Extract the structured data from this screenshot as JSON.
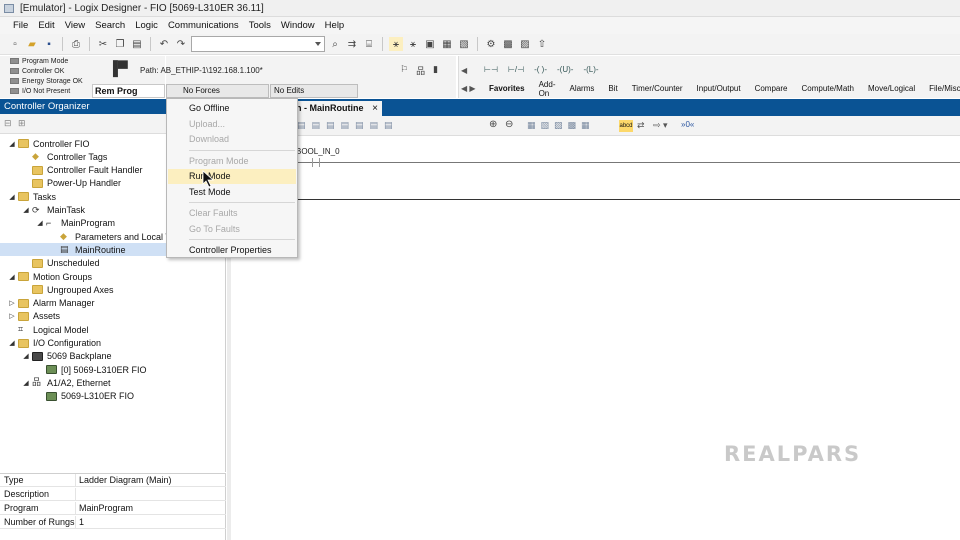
{
  "window": {
    "title": "[Emulator] - Logix Designer - FIO [5069-L310ER 36.11]"
  },
  "menu": [
    "File",
    "Edit",
    "View",
    "Search",
    "Logic",
    "Communications",
    "Tools",
    "Window",
    "Help"
  ],
  "status": {
    "indicators": [
      "Program Mode",
      "Controller OK",
      "Energy Storage OK",
      "I/O Not Present"
    ],
    "mode": "Rem Prog",
    "forces": "No Forces",
    "edits": "No Edits",
    "path_label": "Path:",
    "path_value": "AB_ETHIP-1\\192.168.1.100*"
  },
  "instruction_tabs": [
    "Favorites",
    "Add-On",
    "Alarms",
    "Bit",
    "Timer/Counter",
    "Input/Output",
    "Compare",
    "Compute/Math",
    "Move/Logical",
    "File/Misc."
  ],
  "instruction_icons": [
    "⊢⊣",
    "⊢/⊣",
    "-( )-",
    "-(U)-",
    "-(L)-"
  ],
  "organizer": {
    "title": "Controller Organizer",
    "tree": [
      {
        "label": "Controller FIO",
        "level": 0,
        "toggle": "◢",
        "icon": "folder"
      },
      {
        "label": "Controller Tags",
        "level": 1,
        "toggle": "",
        "icon": "tag"
      },
      {
        "label": "Controller Fault Handler",
        "level": 1,
        "toggle": "",
        "icon": "folder"
      },
      {
        "label": "Power-Up Handler",
        "level": 1,
        "toggle": "",
        "icon": "folder"
      },
      {
        "label": "Tasks",
        "level": 0,
        "toggle": "◢",
        "icon": "folder"
      },
      {
        "label": "MainTask",
        "level": 1,
        "toggle": "◢",
        "icon": "task"
      },
      {
        "label": "MainProgram",
        "level": 2,
        "toggle": "◢",
        "icon": "prog"
      },
      {
        "label": "Parameters and Local Tags",
        "level": 3,
        "toggle": "",
        "icon": "tag"
      },
      {
        "label": "MainRoutine",
        "level": 3,
        "toggle": "",
        "icon": "routine",
        "selected": true
      },
      {
        "label": "Unscheduled",
        "level": 1,
        "toggle": "",
        "icon": "folder"
      },
      {
        "label": "Motion Groups",
        "level": 0,
        "toggle": "◢",
        "icon": "folder"
      },
      {
        "label": "Ungrouped Axes",
        "level": 1,
        "toggle": "",
        "icon": "folder"
      },
      {
        "label": "Alarm Manager",
        "level": 0,
        "toggle": "▷",
        "icon": "folder"
      },
      {
        "label": "Assets",
        "level": 0,
        "toggle": "▷",
        "icon": "folder"
      },
      {
        "label": "Logical Model",
        "level": 0,
        "toggle": "",
        "icon": "logic"
      },
      {
        "label": "I/O Configuration",
        "level": 0,
        "toggle": "◢",
        "icon": "folder"
      },
      {
        "label": "5069 Backplane",
        "level": 1,
        "toggle": "◢",
        "icon": "chip"
      },
      {
        "label": "[0] 5069-L310ER FIO",
        "level": 2,
        "toggle": "",
        "icon": "mod"
      },
      {
        "label": "A1/A2, Ethernet",
        "level": 1,
        "toggle": "◢",
        "icon": "net"
      },
      {
        "label": "5069-L310ER FIO",
        "level": 2,
        "toggle": "",
        "icon": "mod"
      }
    ]
  },
  "properties": [
    {
      "key": "Type",
      "value": "Ladder Diagram (Main)"
    },
    {
      "key": "Description",
      "value": ""
    },
    {
      "key": "Program",
      "value": "MainProgram"
    },
    {
      "key": "Number of Rungs",
      "value": "1"
    }
  ],
  "editor": {
    "tab_label": "n - MainRoutine",
    "tab_close": "×",
    "contact_label": "BOOL_IN_0"
  },
  "dropdown": {
    "items": [
      {
        "label": "Go Offline",
        "enabled": true
      },
      {
        "label": "Upload...",
        "enabled": false
      },
      {
        "label": "Download",
        "enabled": false
      },
      {
        "sep": true
      },
      {
        "label": "Program Mode",
        "enabled": false
      },
      {
        "label": "Run Mode",
        "enabled": true,
        "highlighted": true
      },
      {
        "label": "Test Mode",
        "enabled": true
      },
      {
        "sep": true
      },
      {
        "label": "Clear Faults",
        "enabled": false
      },
      {
        "label": "Go To Faults",
        "enabled": false
      },
      {
        "sep": true
      },
      {
        "label": "Controller Properties",
        "enabled": true
      }
    ]
  },
  "watermark": "REALPARS"
}
